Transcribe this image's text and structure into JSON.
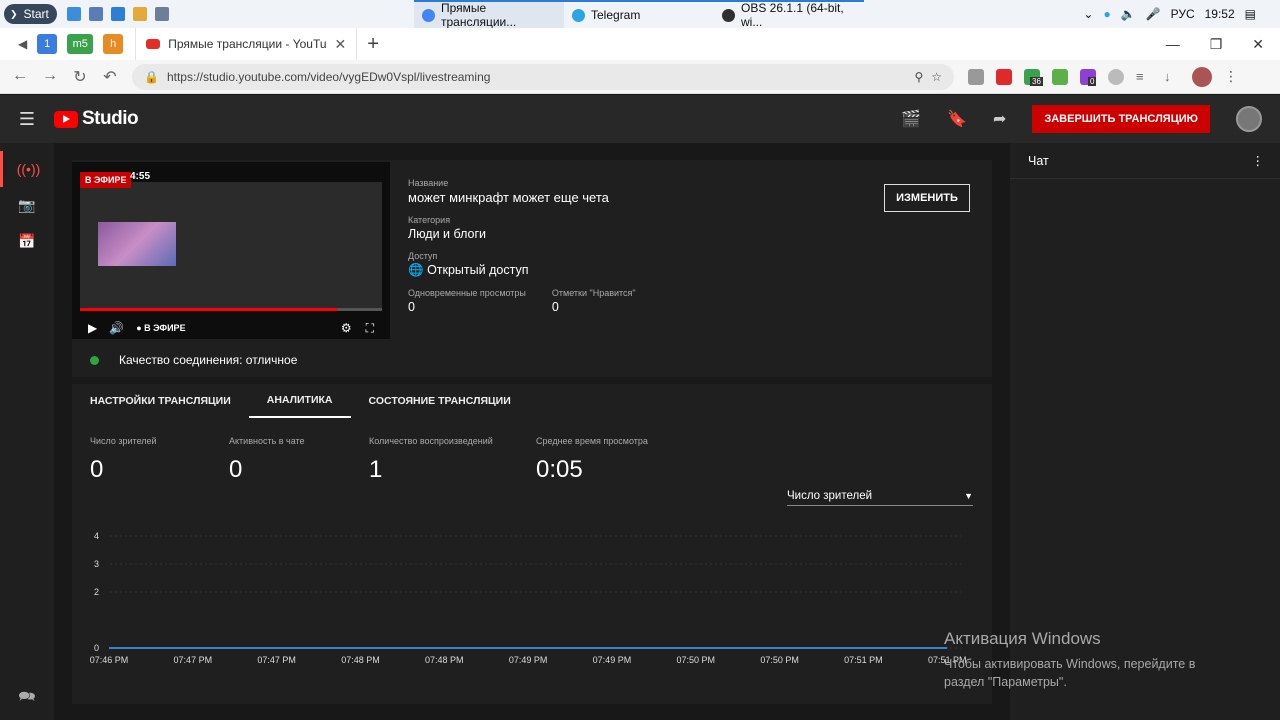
{
  "taskbar": {
    "start_label": "Start",
    "apps": [
      {
        "label": "Прямые трансляции...",
        "color": "#4285f4"
      },
      {
        "label": "Telegram",
        "color": "#2ca5e0"
      },
      {
        "label": "OBS 26.1.1 (64-bit, wi...",
        "color": "#303030"
      }
    ],
    "lang": "РУС",
    "time": "19:52"
  },
  "browser": {
    "mini_tab_1": "1",
    "mini_tab_2": "m5",
    "mini_tab_3": "h",
    "tab_title": "Прямые трансляции - YouTube",
    "url": "https://studio.youtube.com/video/vygEDw0Vspl/livestreaming",
    "ext_badge_1": "36",
    "ext_badge_2": "0"
  },
  "studio": {
    "logo_text": "Studio",
    "end_stream_label": "ЗАВЕРШИТЬ ТРАНСЛЯЦИЮ",
    "preview": {
      "live_badge": "В ЭФИРЕ",
      "elapsed": "4:55",
      "live_control_label": "В ЭФИРЕ",
      "progress_fraction": 0.85
    },
    "info": {
      "title_label": "Название",
      "title_value": "может минкрафт может еще чета",
      "category_label": "Категория",
      "category_value": "Люди и блоги",
      "access_label": "Доступ",
      "access_value": "Открытый доступ",
      "concurrent_label": "Одновременные просмотры",
      "concurrent_value": "0",
      "likes_label": "Отметки \"Нравится\"",
      "likes_value": "0"
    },
    "edit_label": "ИЗМЕНИТЬ",
    "connection_quality": "Качество соединения: отличное",
    "tabs": [
      "НАСТРОЙКИ ТРАНСЛЯЦИИ",
      "АНАЛИТИКА",
      "СОСТОЯНИЕ ТРАНСЛЯЦИИ"
    ],
    "metrics": [
      {
        "label": "Число зрителей",
        "value": "0"
      },
      {
        "label": "Активность в чате",
        "value": "0"
      },
      {
        "label": "Количество воспроизведений",
        "value": "1"
      },
      {
        "label": "Среднее время просмотра",
        "value": "0:05"
      }
    ],
    "dropdown_value": "Число зрителей",
    "chat_title": "Чат"
  },
  "chart_data": {
    "type": "line",
    "x": [
      "07:46 PM",
      "07:47 PM",
      "07:47 PM",
      "07:48 PM",
      "07:48 PM",
      "07:49 PM",
      "07:49 PM",
      "07:50 PM",
      "07:50 PM",
      "07:51 PM",
      "07:51 PM"
    ],
    "series": [
      {
        "values": [
          0,
          0,
          0,
          0,
          0,
          0,
          0,
          0,
          0,
          0,
          0
        ]
      }
    ],
    "yticks": [
      0,
      2,
      3,
      4
    ],
    "ylim": [
      0,
      4
    ],
    "grid": true,
    "line_color": "#3ea6ff"
  },
  "watermark": {
    "title": "Активация Windows",
    "line1": "Чтобы активировать Windows, перейдите в",
    "line2": "раздел \"Параметры\"."
  }
}
